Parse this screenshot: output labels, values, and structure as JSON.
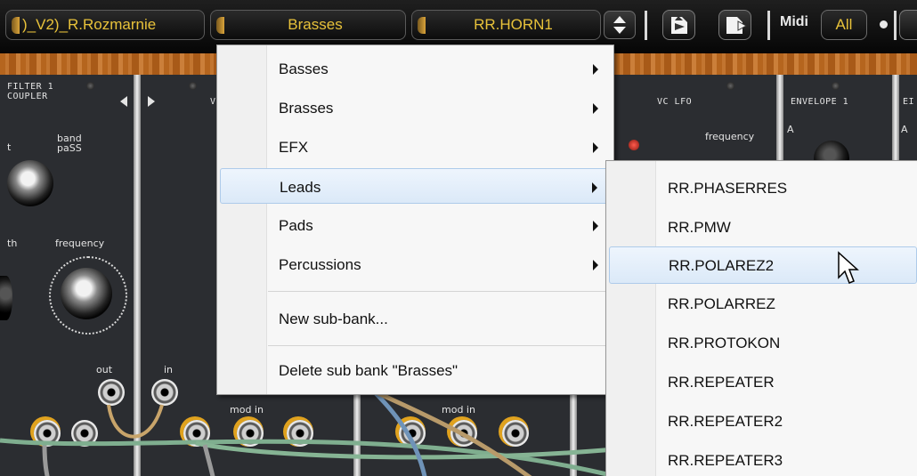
{
  "toolbar": {
    "patch_name": ")_V2)_R.Rozmarnie",
    "bank": "Brasses",
    "preset": "RR.HORN1",
    "midi_label": "Midi",
    "midi_channel": "All"
  },
  "synth_panel": {
    "filter_title": "FILTER 1\nCOUPLER",
    "band_pass": "band\npaSS",
    "frequency_left": "frequency",
    "frag_t": "t",
    "frag_th": "th",
    "out_label": "out",
    "in_label": "in",
    "mod_in_1": "mod in",
    "mod_in_2": "mod in",
    "vc_lfo": "VC LFO",
    "lfo_frequency": "frequency",
    "envelope_1": "ENVELOPE 1",
    "frag_v": "V",
    "frag_en": "EI",
    "env_a": "A"
  },
  "bank_menu": {
    "items": [
      {
        "label": "Basses",
        "has_submenu": true,
        "highlighted": false
      },
      {
        "label": "Brasses",
        "has_submenu": true,
        "highlighted": false
      },
      {
        "label": "EFX",
        "has_submenu": true,
        "highlighted": false
      },
      {
        "label": "Leads",
        "has_submenu": true,
        "highlighted": true
      },
      {
        "label": "Pads",
        "has_submenu": true,
        "highlighted": false
      },
      {
        "label": "Percussions",
        "has_submenu": true,
        "highlighted": false
      }
    ],
    "new_sub_bank": "New sub-bank...",
    "delete_sub_bank": "Delete sub bank \"Brasses\""
  },
  "leads_submenu": {
    "items": [
      {
        "label": "RR.PHASERRES",
        "highlighted": false
      },
      {
        "label": "RR.PMW",
        "highlighted": false
      },
      {
        "label": "RR.POLAREZ2",
        "highlighted": true
      },
      {
        "label": "RR.POLARREZ",
        "highlighted": false
      },
      {
        "label": "RR.PROTOKON",
        "highlighted": false
      },
      {
        "label": "RR.REPEATER",
        "highlighted": false
      },
      {
        "label": "RR.REPEATER2",
        "highlighted": false
      },
      {
        "label": "RR.REPEATER3",
        "highlighted": false
      }
    ]
  },
  "colors": {
    "toolbar_text": "#e8c23a",
    "menu_highlight": "#dbe9f8",
    "wood": "#b5651e",
    "panel": "#2b2d31"
  }
}
